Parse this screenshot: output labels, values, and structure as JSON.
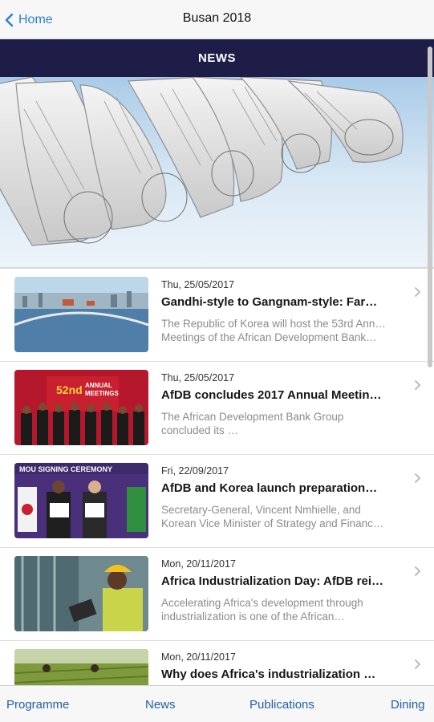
{
  "navbar": {
    "back_label": "Home",
    "title": "Busan 2018"
  },
  "section": {
    "title": "NEWS"
  },
  "articles": [
    {
      "date": "Thu, 25/05/2017",
      "title": "Gandhi-style to Gangnam-style: Far…",
      "desc_line1": "The Republic of Korea will host the 53rd Annual",
      "desc_line2": "Meetings of the African Development Bank…"
    },
    {
      "date": "Thu, 25/05/2017",
      "title": "AfDB concludes 2017 Annual Meetin…",
      "desc_line1": "The African Development Bank Group",
      "desc_line2": "concluded its …"
    },
    {
      "date": "Fri, 22/09/2017",
      "title": "AfDB and Korea launch preparation…",
      "desc_line1": "Secretary-General, Vincent Nmhielle, and",
      "desc_line2": "Korean Vice Minister of Strategy and Finance,…"
    },
    {
      "date": "Mon, 20/11/2017",
      "title": "Africa Industrialization Day: AfDB rei…",
      "desc_line1": "Accelerating Africa's development through",
      "desc_line2": "industrialization is one of the African…"
    },
    {
      "date": "Mon, 20/11/2017",
      "title": "Why does Africa's industrialization …",
      "desc_line1": "",
      "desc_line2": ""
    }
  ],
  "thumb_text": {
    "banner_52nd": "52nd",
    "banner_annual": "ANNUAL",
    "banner_meetings": "MEETINGS",
    "mou": "MOU SIGNING CEREMONY"
  },
  "tabbar": {
    "tabs": [
      "Programme",
      "News",
      "Publications",
      "Dining"
    ]
  },
  "colors": {
    "accent": "#2b7fd1",
    "header_bg": "#1e1d48",
    "tab_text": "#1f5fa6"
  }
}
